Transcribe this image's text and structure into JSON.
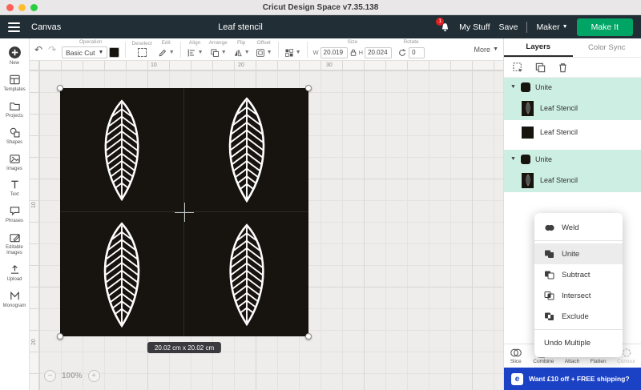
{
  "titlebar": {
    "title": "Cricut Design Space  v7.35.138"
  },
  "header": {
    "canvas_label": "Canvas",
    "document_title": "Leaf stencil",
    "notification_count": "1",
    "my_stuff_label": "My Stuff",
    "save_label": "Save",
    "machine_label": "Maker",
    "make_it_label": "Make It"
  },
  "toolbar": {
    "operation_label": "Operation",
    "operation_value": "Basic Cut",
    "deselect_label": "Deselect",
    "edit_label": "Edit",
    "align_label": "Align",
    "arrange_label": "Arrange",
    "flip_label": "Flip",
    "offset_label": "Offset",
    "size_label": "Size",
    "w_label": "W",
    "w_value": "20.019",
    "h_label": "H",
    "h_value": "20.024",
    "rotate_label": "Rotate",
    "rotate_value": "0",
    "more_label": "More"
  },
  "sidebar": {
    "items": [
      {
        "label": "New"
      },
      {
        "label": "Templates"
      },
      {
        "label": "Projects"
      },
      {
        "label": "Shapes"
      },
      {
        "label": "Images"
      },
      {
        "label": "Text"
      },
      {
        "label": "Phrases"
      },
      {
        "label": "Editable Images"
      },
      {
        "label": "Upload"
      },
      {
        "label": "Monogram"
      }
    ]
  },
  "canvas": {
    "ruler_h": [
      "10",
      "20",
      "30"
    ],
    "ruler_v": [
      "10",
      "20"
    ],
    "dimension_label": "20.02 cm x 20.02 cm",
    "zoom": "100%"
  },
  "layers_panel": {
    "tabs": [
      {
        "label": "Layers"
      },
      {
        "label": "Color Sync"
      }
    ],
    "groups": [
      {
        "label": "Unite",
        "items": [
          {
            "label": "Leaf Stencil"
          },
          {
            "label": "Leaf Stencil"
          }
        ]
      },
      {
        "label": "Unite",
        "items": [
          {
            "label": "Leaf Stencil"
          }
        ]
      }
    ],
    "bottom_actions": [
      {
        "label": "Slice"
      },
      {
        "label": "Combine"
      },
      {
        "label": "Attach"
      },
      {
        "label": "Flatten"
      },
      {
        "label": "Contour"
      }
    ]
  },
  "context_menu": {
    "items": [
      {
        "label": "Weld"
      },
      {
        "label": "Unite"
      },
      {
        "label": "Subtract"
      },
      {
        "label": "Intersect"
      },
      {
        "label": "Exclude"
      },
      {
        "label": "Undo Multiple"
      }
    ]
  },
  "promo": {
    "logo": "e",
    "text": "Want £10 off + FREE shipping?"
  },
  "colors": {
    "accent_green": "#00a465",
    "mint": "#cdeee2",
    "promo_blue": "#1b41c4",
    "header_dark": "#212e36",
    "layer_black": "#17130f"
  }
}
